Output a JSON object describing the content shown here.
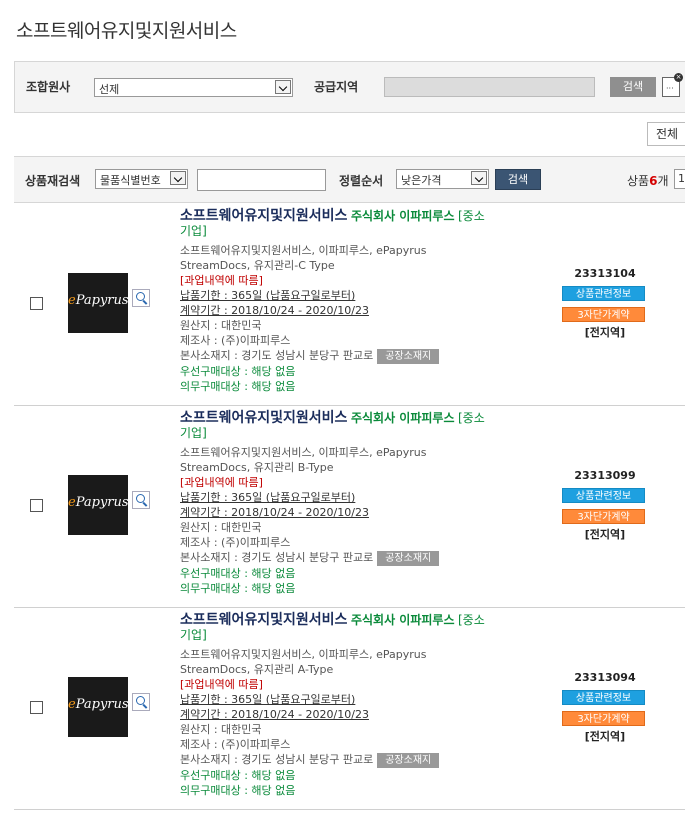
{
  "page_title": "소프트웨어유지및지원서비스",
  "search": {
    "org_label": "조합원사",
    "org_value": "선제",
    "region_label": "공급지역",
    "search_button": "검색"
  },
  "all_button": "전체",
  "filter": {
    "research_label": "상품재검색",
    "research_select": "물품식별번호",
    "sort_label": "정렬순서",
    "sort_select": "낮은가격",
    "search_button": "검색",
    "count_prefix": "상품",
    "count_value": "6",
    "count_suffix": "개",
    "page_value": "1"
  },
  "products": [
    {
      "name": "소프트웨어유지및지원서비스",
      "vendor": "주식회사 이파피루스",
      "class_open": "[중소",
      "class_close": "기업]",
      "spec1": "소프트웨어유지및지원서비스, 이파피루스, ePapyrus",
      "spec2": "StreamDocs, 유지관리-C Type",
      "overcharge": "[과업내역에 따름]",
      "delivery": "납품기한 : 365일 (납품요구일로부터)",
      "contract": "계약기간 : 2018/10/24 - 2020/10/23",
      "origin": "원산지 : 대한민국",
      "maker": "제조사 : (주)이파피루스",
      "hq": "본사소재지 : 경기도 성남시 분당구 판교로",
      "factory_button": "공장소재지",
      "priority": "우선구매대상 : 해당 없음",
      "mandatory": "의무구매대상 : 해당 없음",
      "number": "23313104",
      "info_button": "상품관련정보",
      "contract_button": "3자단가계약",
      "region": "[전지역]",
      "logo_e": "e",
      "logo_rest": "Papyrus"
    },
    {
      "name": "소프트웨어유지및지원서비스",
      "vendor": "주식회사 이파피루스",
      "class_open": "[중소",
      "class_close": "기업]",
      "spec1": "소프트웨어유지및지원서비스, 이파피루스, ePapyrus",
      "spec2": "StreamDocs, 유지관리 B-Type",
      "overcharge": "[과업내역에 따름]",
      "delivery": "납품기한 : 365일 (납품요구일로부터)",
      "contract": "계약기간 : 2018/10/24 - 2020/10/23",
      "origin": "원산지 : 대한민국",
      "maker": "제조사 : (주)이파피루스",
      "hq": "본사소재지 : 경기도 성남시 분당구 판교로",
      "factory_button": "공장소재지",
      "priority": "우선구매대상 : 해당 없음",
      "mandatory": "의무구매대상 : 해당 없음",
      "number": "23313099",
      "info_button": "상품관련정보",
      "contract_button": "3자단가계약",
      "region": "[전지역]",
      "logo_e": "e",
      "logo_rest": "Papyrus"
    },
    {
      "name": "소프트웨어유지및지원서비스",
      "vendor": "주식회사 이파피루스",
      "class_open": "[중소",
      "class_close": "기업]",
      "spec1": "소프트웨어유지및지원서비스, 이파피루스, ePapyrus",
      "spec2": "StreamDocs, 유지관리 A-Type",
      "overcharge": "[과업내역에 따름]",
      "delivery": "납품기한 : 365일 (납품요구일로부터)",
      "contract": "계약기간 : 2018/10/24 - 2020/10/23",
      "origin": "원산지 : 대한민국",
      "maker": "제조사 : (주)이파피루스",
      "hq": "본사소재지 : 경기도 성남시 분당구 판교로",
      "factory_button": "공장소재지",
      "priority": "우선구매대상 : 해당 없음",
      "mandatory": "의무구매대상 : 해당 없음",
      "number": "23313094",
      "info_button": "상품관련정보",
      "contract_button": "3자단가계약",
      "region": "[전지역]",
      "logo_e": "e",
      "logo_rest": "Papyrus"
    }
  ]
}
